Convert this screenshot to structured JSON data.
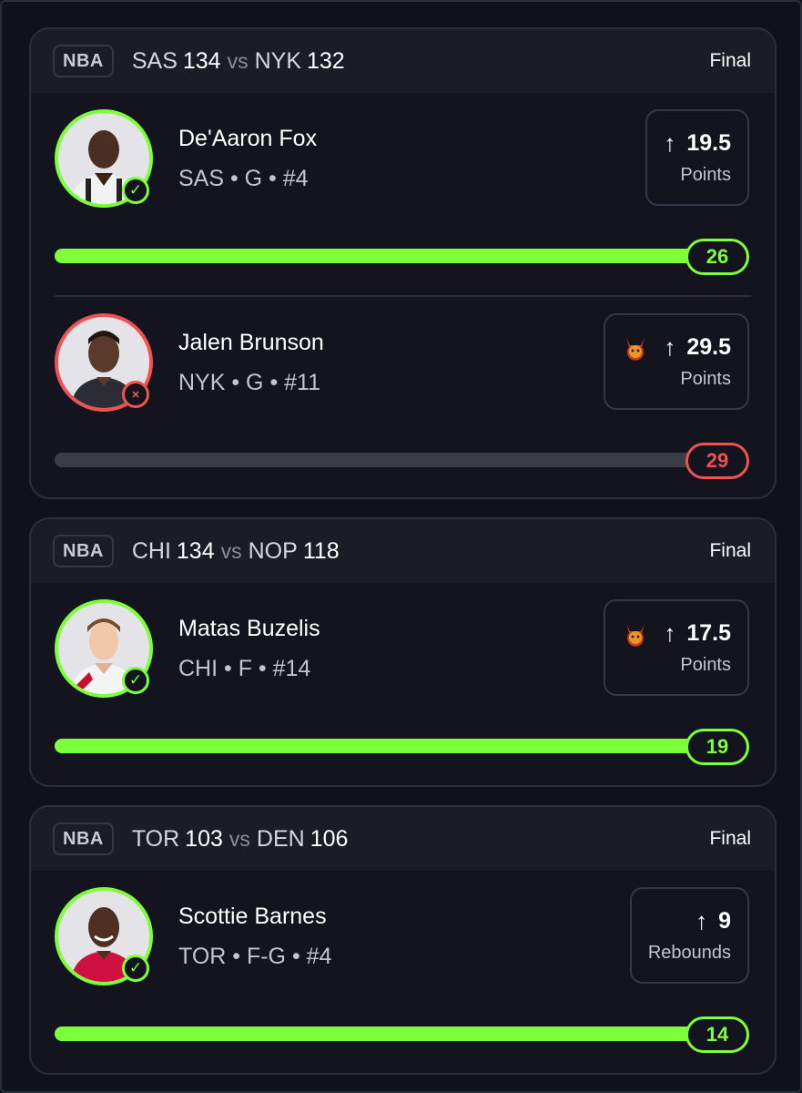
{
  "games": [
    {
      "league": "NBA",
      "away_team": "SAS",
      "away_score": "134",
      "vs": "vs",
      "home_team": "NYK",
      "home_score": "132",
      "status": "Final",
      "picks": [
        {
          "name": "De'Aaron Fox",
          "meta": "SAS • G • #4",
          "line": "19.5",
          "direction_icon": "arrow-up-icon",
          "stat": "Points",
          "result": "26",
          "progress": 1.0,
          "outcome": "hit",
          "boost": false
        },
        {
          "name": "Jalen Brunson",
          "meta": "NYK • G • #11",
          "line": "29.5",
          "direction_icon": "arrow-up-icon",
          "stat": "Points",
          "result": "29",
          "progress": 0.98,
          "outcome": "miss",
          "boost": true
        }
      ]
    },
    {
      "league": "NBA",
      "away_team": "CHI",
      "away_score": "134",
      "vs": "vs",
      "home_team": "NOP",
      "home_score": "118",
      "status": "Final",
      "picks": [
        {
          "name": "Matas Buzelis",
          "meta": "CHI • F • #14",
          "line": "17.5",
          "direction_icon": "arrow-up-icon",
          "stat": "Points",
          "result": "19",
          "progress": 1.0,
          "outcome": "hit",
          "boost": true
        }
      ]
    },
    {
      "league": "NBA",
      "away_team": "TOR",
      "away_score": "103",
      "vs": "vs",
      "home_team": "DEN",
      "home_score": "106",
      "status": "Final",
      "picks": [
        {
          "name": "Scottie Barnes",
          "meta": "TOR • F-G • #4",
          "line": "9",
          "direction_icon": "arrow-up-icon",
          "stat": "Rebounds",
          "result": "14",
          "progress": 1.0,
          "outcome": "hit",
          "boost": false
        }
      ]
    }
  ],
  "colors": {
    "hit": "#7dff3a",
    "miss": "#f05252",
    "track": "#3a3c46",
    "background": "#10111a",
    "card": "#13141d",
    "header": "#1b1c26"
  },
  "icons": {
    "direction_up": "↑",
    "check": "✓",
    "cross": "×"
  }
}
